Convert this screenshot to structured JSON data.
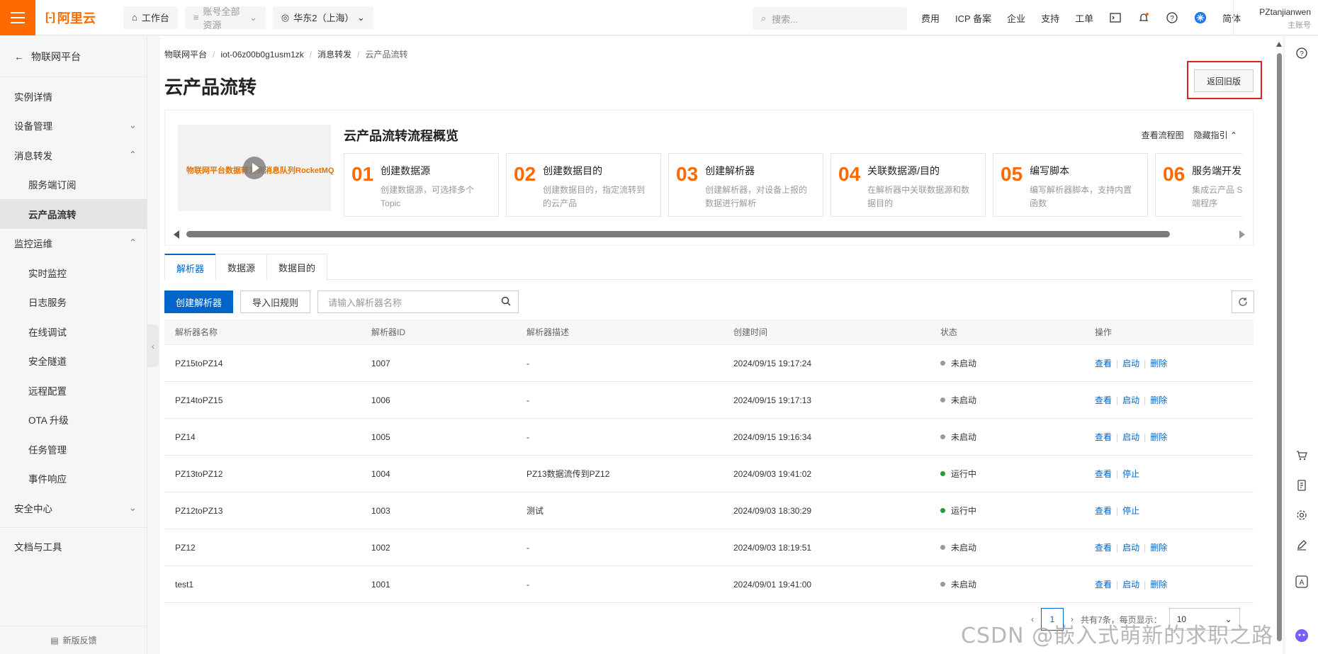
{
  "topbar": {
    "logo_mark": "[-]",
    "logo_text": "阿里云",
    "workbench": "工作台",
    "all_resources": "账号全部资源",
    "region": "华东2（上海）",
    "search_placeholder": "搜索...",
    "links": [
      "费用",
      "ICP 备案",
      "企业",
      "支持",
      "工单"
    ],
    "lang": "简体",
    "user_name": "PZtanjianwen",
    "user_role": "主账号"
  },
  "sidebar": {
    "back_label": "物联网平台",
    "items": [
      {
        "label": "实例详情",
        "type": "top"
      },
      {
        "label": "设备管理",
        "type": "group",
        "chevron": "down"
      },
      {
        "label": "消息转发",
        "type": "group",
        "chevron": "up"
      },
      {
        "label": "服务端订阅",
        "type": "sub"
      },
      {
        "label": "云产品流转",
        "type": "sub",
        "active": true
      },
      {
        "label": "监控运维",
        "type": "group",
        "chevron": "up"
      },
      {
        "label": "实时监控",
        "type": "sub"
      },
      {
        "label": "日志服务",
        "type": "sub"
      },
      {
        "label": "在线调试",
        "type": "sub"
      },
      {
        "label": "安全隧道",
        "type": "sub"
      },
      {
        "label": "远程配置",
        "type": "sub"
      },
      {
        "label": "OTA 升级",
        "type": "sub"
      },
      {
        "label": "任务管理",
        "type": "sub"
      },
      {
        "label": "事件响应",
        "type": "sub"
      },
      {
        "label": "安全中心",
        "type": "group",
        "chevron": "down"
      }
    ],
    "docs_label": "文档与工具",
    "footer": "新版反馈"
  },
  "breadcrumb": [
    "物联网平台",
    "iot-06z00b0g1usm1zk",
    "消息转发",
    "云产品流转"
  ],
  "page_title": "云产品流转",
  "old_version_btn": "返回旧版",
  "guide": {
    "video_text": "物联网平台数据转发到消息队列RocketMQ",
    "title": "云产品流转流程概览",
    "view_flow": "查看流程图",
    "hide_guide": "隐藏指引",
    "steps": [
      {
        "num": "01",
        "title": "创建数据源",
        "desc": "创建数据源，可选择多个Topic"
      },
      {
        "num": "02",
        "title": "创建数据目的",
        "desc": "创建数据目的，指定流转到的云产品"
      },
      {
        "num": "03",
        "title": "创建解析器",
        "desc": "创建解析器，对设备上报的数据进行解析"
      },
      {
        "num": "04",
        "title": "关联数据源/目的",
        "desc": "在解析器中关联数据源和数据目的"
      },
      {
        "num": "05",
        "title": "编写脚本",
        "desc": "编写解析器脚本，支持内置函数"
      },
      {
        "num": "06",
        "title": "服务端开发",
        "desc": "集成云产品 SDK，完成服务端程序"
      }
    ]
  },
  "tabs": [
    "解析器",
    "数据源",
    "数据目的"
  ],
  "toolbar": {
    "create_btn": "创建解析器",
    "import_btn": "导入旧规则",
    "search_placeholder": "请输入解析器名称"
  },
  "table": {
    "headers": [
      "解析器名称",
      "解析器ID",
      "解析器描述",
      "创建时间",
      "状态",
      "操作"
    ],
    "rows": [
      {
        "name": "PZ15toPZ14",
        "id": "1007",
        "desc": "-",
        "time": "2024/09/15 19:17:24",
        "status": "未启动",
        "running": false,
        "ops": [
          "查看",
          "启动",
          "删除"
        ]
      },
      {
        "name": "PZ14toPZ15",
        "id": "1006",
        "desc": "-",
        "time": "2024/09/15 19:17:13",
        "status": "未启动",
        "running": false,
        "ops": [
          "查看",
          "启动",
          "删除"
        ]
      },
      {
        "name": "PZ14",
        "id": "1005",
        "desc": "-",
        "time": "2024/09/15 19:16:34",
        "status": "未启动",
        "running": false,
        "ops": [
          "查看",
          "启动",
          "删除"
        ]
      },
      {
        "name": "PZ13toPZ12",
        "id": "1004",
        "desc": "PZ13数据流传到PZ12",
        "time": "2024/09/03 19:41:02",
        "status": "运行中",
        "running": true,
        "ops": [
          "查看",
          "停止"
        ]
      },
      {
        "name": "PZ12toPZ13",
        "id": "1003",
        "desc": "测试",
        "time": "2024/09/03 18:30:29",
        "status": "运行中",
        "running": true,
        "ops": [
          "查看",
          "停止"
        ]
      },
      {
        "name": "PZ12",
        "id": "1002",
        "desc": "-",
        "time": "2024/09/03 18:19:51",
        "status": "未启动",
        "running": false,
        "ops": [
          "查看",
          "启动",
          "删除"
        ]
      },
      {
        "name": "test1",
        "id": "1001",
        "desc": "-",
        "time": "2024/09/01 19:41:00",
        "status": "未启动",
        "running": false,
        "ops": [
          "查看",
          "启动",
          "删除"
        ]
      }
    ]
  },
  "pagination": {
    "current_page": "1",
    "summary": "共有7条，每页显示：",
    "page_size": "10"
  },
  "watermark": "CSDN @嵌入式萌新的求职之路",
  "colors": {
    "brand": "#ff6a00",
    "primary": "#0064c8",
    "running": "#1e9e3c",
    "stopped": "#999999",
    "highlight": "#e02020"
  }
}
